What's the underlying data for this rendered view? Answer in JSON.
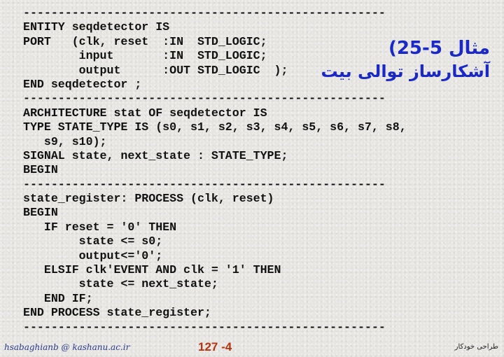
{
  "slide": {
    "title_line1": "مثال 5-25)",
    "title_line2": "آشکارساز توالی بیت",
    "title_color": "#1a28c8",
    "code_lines": [
      "----------------------------------------------------",
      "ENTITY seqdetector IS",
      "PORT   (clk, reset  :IN  STD_LOGIC;",
      "        input       :IN  STD_LOGIC;",
      "        output      :OUT STD_LOGIC  );",
      "END seqdetector ;",
      "----------------------------------------------------",
      "ARCHITECTURE stat OF seqdetector IS",
      "TYPE STATE_TYPE IS (s0, s1, s2, s3, s4, s5, s6, s7, s8,",
      "   s9, s10);",
      "SIGNAL state, next_state : STATE_TYPE;",
      "BEGIN",
      "----------------------------------------------------",
      "state_register: PROCESS (clk, reset)",
      "BEGIN",
      "   IF reset = '0' THEN",
      "        state <= s0;",
      "        output<='0';",
      "   ELSIF clk'EVENT AND clk = '1' THEN",
      "        state <= next_state;",
      "   END IF;",
      "END PROCESS state_register;",
      "----------------------------------------------------"
    ]
  },
  "footer": {
    "email": "hsabaghianb @ kashanu.ac.ir",
    "page": "127 -4",
    "page_color": "#b8320c",
    "course": "طراحی خودکار"
  }
}
